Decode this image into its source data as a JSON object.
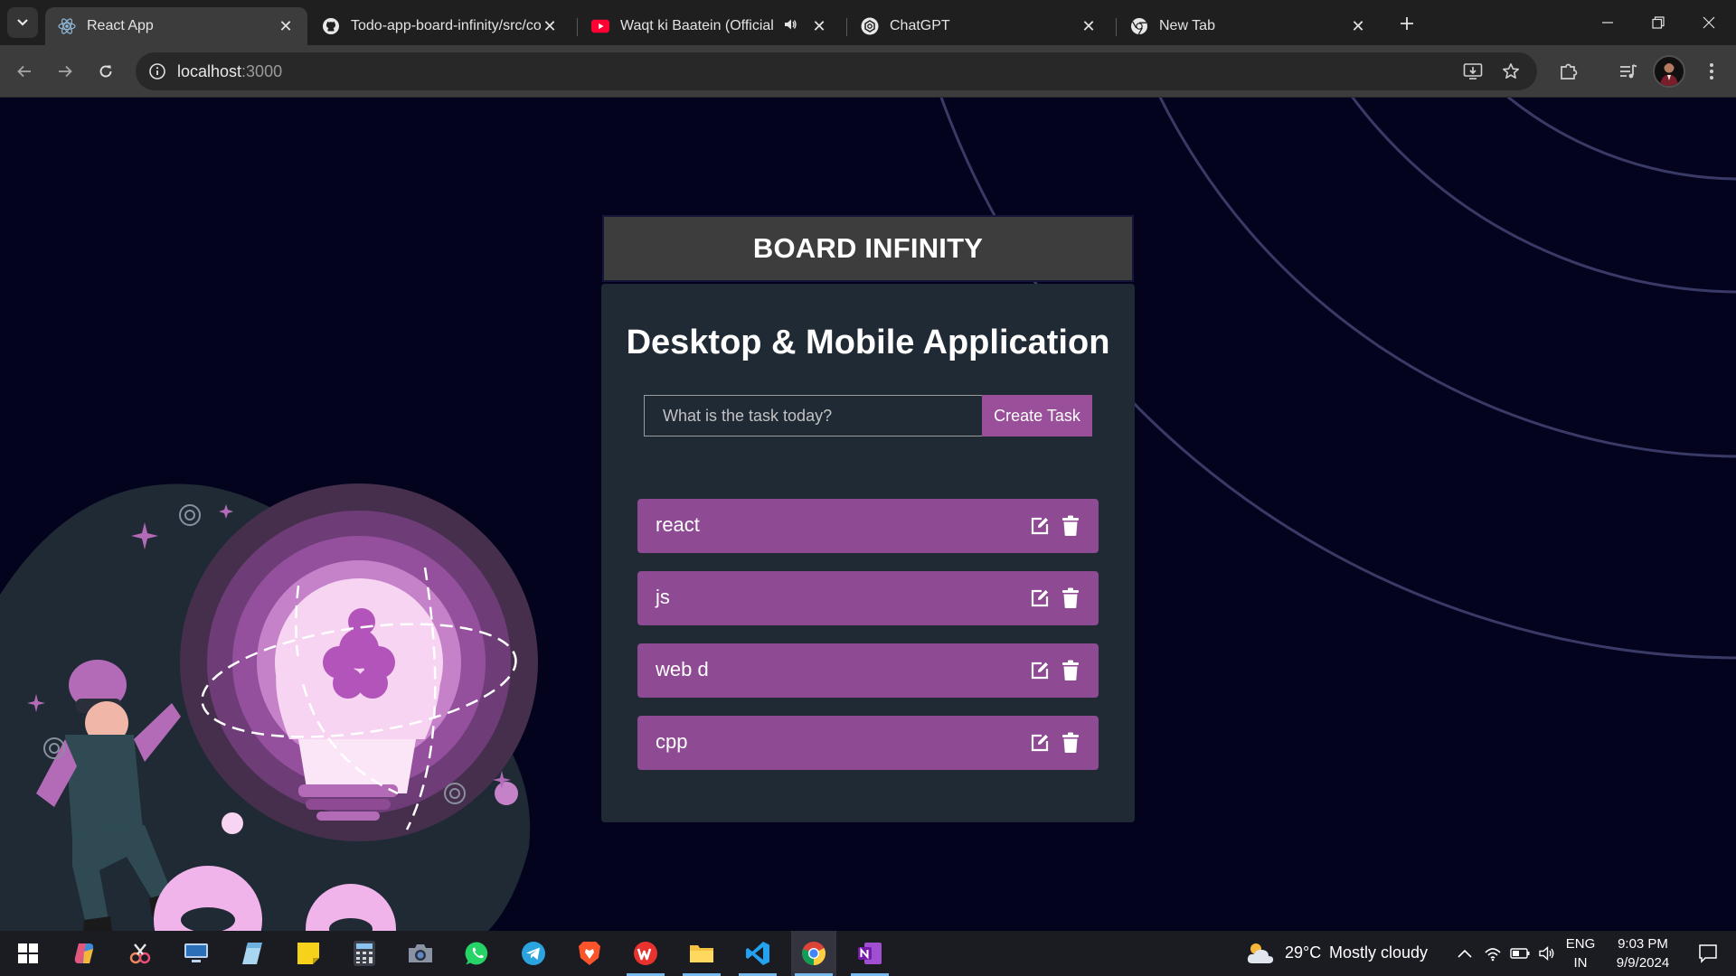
{
  "browser": {
    "tabs": [
      {
        "title": "React App",
        "favicon": "react-icon",
        "active": true
      },
      {
        "title": "Todo-app-board-infinity/src/co",
        "favicon": "github-icon",
        "active": false
      },
      {
        "title": "Waqt ki Baatein (Official Mu",
        "favicon": "youtube-icon",
        "active": false,
        "audio": true
      },
      {
        "title": "ChatGPT",
        "favicon": "chatgpt-icon",
        "active": false
      },
      {
        "title": "New Tab",
        "favicon": "chrome-icon",
        "active": false
      }
    ],
    "url_host": "localhost",
    "url_port": ":3000"
  },
  "app": {
    "brand": "BOARD INFINITY",
    "heading": "Desktop & Mobile Application",
    "input_placeholder": "What is the task today?",
    "create_button": "Create Task",
    "accent_color": "#8e4a93",
    "tasks": [
      {
        "label": "react"
      },
      {
        "label": "js"
      },
      {
        "label": "web d"
      },
      {
        "label": "cpp"
      }
    ]
  },
  "taskbar": {
    "apps": [
      "windows-start-icon",
      "copilot-icon",
      "snipping-tool-icon",
      "remote-desktop-icon",
      "notepad-icon",
      "sticky-notes-icon",
      "calculator-icon",
      "camera-icon",
      "whatsapp-icon",
      "telegram-icon",
      "brave-icon",
      "wps-office-icon",
      "file-explorer-icon",
      "vscode-icon",
      "chrome-icon",
      "onenote-icon"
    ],
    "weather_temp": "29°C",
    "weather_text": "Mostly cloudy",
    "lang_top": "ENG",
    "lang_bottom": "IN",
    "time": "9:03 PM",
    "date": "9/9/2024"
  }
}
